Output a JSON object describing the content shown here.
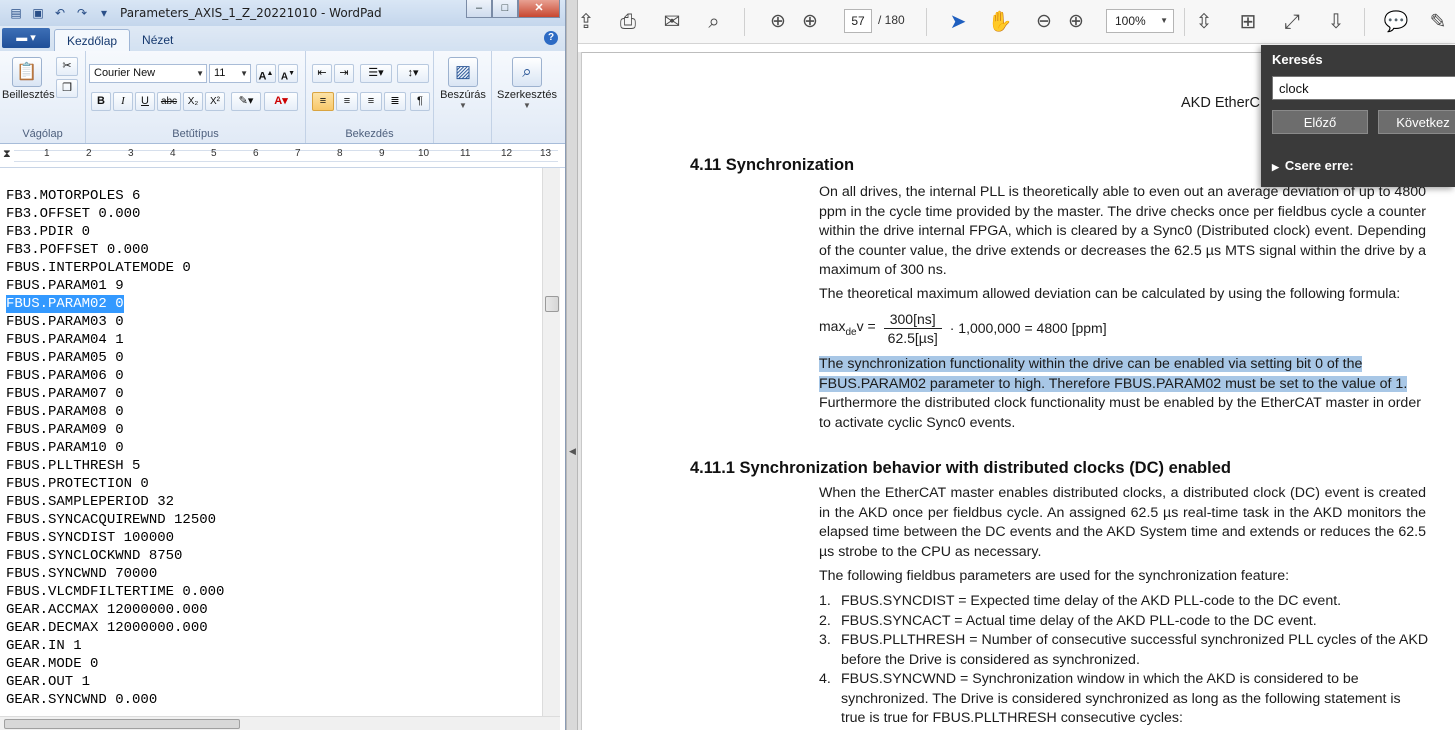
{
  "wordpad": {
    "title": "Parameters_AXIS_1_Z_20221010 - WordPad",
    "tabs": [
      "Kezdőlap",
      "Nézet"
    ],
    "ribbon": {
      "paste_label": "Beillesztés",
      "clipboard_group": "Vágólap",
      "font_name": "Courier New",
      "font_size": "11",
      "font_group": "Betűtípus",
      "paragraph_group": "Bekezdés",
      "insert_label": "Beszúrás",
      "edit_label": "Szerkesztés"
    },
    "ruler_numbers": [
      "1",
      "2",
      "3",
      "4",
      "5",
      "6",
      "7",
      "8",
      "9",
      "10",
      "11",
      "12",
      "13"
    ],
    "lines": [
      "FB3.MOTORPOLES 6",
      "FB3.OFFSET 0.000",
      "FB3.PDIR 0",
      "FB3.POFFSET 0.000",
      "FBUS.INTERPOLATEMODE 0",
      "FBUS.PARAM01 9",
      "FBUS.PARAM02 0",
      "FBUS.PARAM03 0",
      "FBUS.PARAM04 1",
      "FBUS.PARAM05 0",
      "FBUS.PARAM06 0",
      "FBUS.PARAM07 0",
      "FBUS.PARAM08 0",
      "FBUS.PARAM09 0",
      "FBUS.PARAM10 0",
      "FBUS.PLLTHRESH 5",
      "FBUS.PROTECTION 0",
      "FBUS.SAMPLEPERIOD 32",
      "FBUS.SYNCACQUIREWND 12500",
      "FBUS.SYNCDIST 100000",
      "FBUS.SYNCLOCKWND 8750",
      "FBUS.SYNCWND 70000",
      "FBUS.VLCMDFILTERTIME 0.000",
      "GEAR.ACCMAX 12000000.000",
      "GEAR.DECMAX 12000000.000",
      "GEAR.IN 1",
      "GEAR.MODE 0",
      "GEAR.OUT 1",
      "GEAR.SYNCWND 0.000"
    ],
    "selected_line_index": 6
  },
  "pdf": {
    "page_current": "57",
    "page_total": "/ 180",
    "zoom": "100%",
    "header_right": "AKD EtherC",
    "section_title": "4.11   Synchronization",
    "p1": "On all drives, the internal PLL is theoretically able to even out an average deviation of up to 4800 ppm in the cycle time provided by the master. The drive checks once per fieldbus cycle a counter within the drive internal FPGA, which is cleared by a Sync0 (Distributed clock) event. Depending of the counter value, the drive extends or decreases the 62.5 µs MTS signal within the drive by a maximum of 300 ns.",
    "p2": "The theoretical maximum allowed deviation can be calculated by using the following formula:",
    "formula": {
      "lhs_main": "max",
      "lhs_sub": "de",
      "lhs_tail": "v =",
      "numerator": "300[ns]",
      "denominator": "62.5[µs]",
      "rhs": "· 1,000,000 = 4800 [ppm]"
    },
    "p3_highlight": "The synchronization functionality within the drive can be enabled via setting bit 0 of the FBUS.PARAM02 parameter to high. Therefore FBUS.PARAM02 must be set to the value of 1.",
    "p3_rest": " Furthermore the distributed clock functionality must be enabled by the EtherCAT master in order to activate cyclic Sync0 events.",
    "subsection_title": "4.11.1 Synchronization behavior with distributed clocks (DC) enabled",
    "p4": "When the EtherCAT master enables distributed clocks, a distributed clock (DC) event is created in the AKD once per fieldbus cycle. An assigned 62.5 µs real-time task in the AKD monitors the elapsed time between the DC events and the AKD System time and extends or reduces the 62.5 µs strobe to the CPU as necessary.",
    "p5": "The following fieldbus parameters are used for the synchronization feature:",
    "list": [
      {
        "n": "1.",
        "text": "FBUS.SYNCDIST = Expected time delay of the AKD PLL-code to the DC event."
      },
      {
        "n": "2.",
        "text": "FBUS.SYNCACT = Actual time delay of the AKD PLL-code to the DC event."
      },
      {
        "n": "3.",
        "text": "FBUS.PLLTHRESH = Number of consecutive successful synchronized PLL cycles of the AKD before the Drive is considered as synchronized."
      },
      {
        "n": "4.",
        "text": "FBUS.SYNCWND = Synchronization window in which the AKD is considered to be synchronized. The Drive is considered synchronized as long as the following statement is true is true for FBUS.PLLTHRESH consecutive cycles:"
      }
    ]
  },
  "find": {
    "label": "Keresés",
    "value": "clock",
    "prev_label": "Előző",
    "next_label": "Következ",
    "replace_label": "Csere erre:"
  }
}
